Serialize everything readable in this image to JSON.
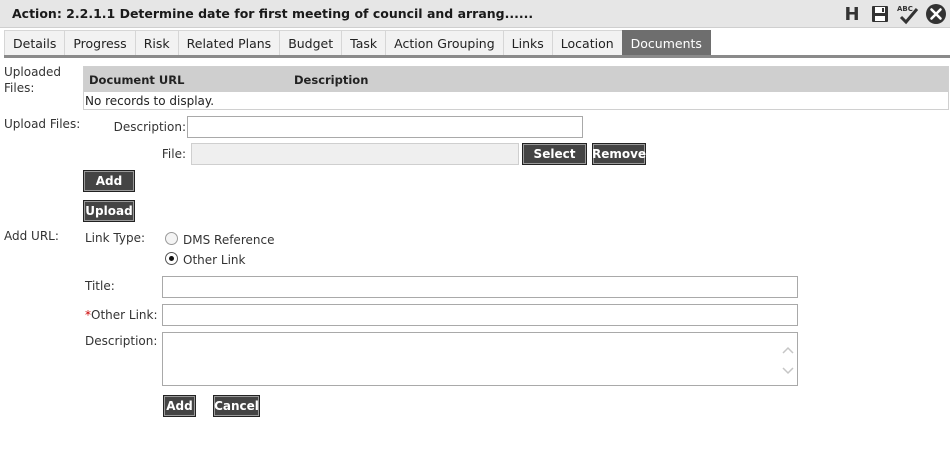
{
  "window": {
    "title": "Action: 2.2.1.1 Determine date for first meeting of council and arrang......",
    "icons": [
      "h-icon",
      "save-icon",
      "spellcheck-icon",
      "close-icon"
    ],
    "h_label": "H",
    "spell_label": "ABC"
  },
  "tabs": [
    {
      "label": "Details"
    },
    {
      "label": "Progress"
    },
    {
      "label": "Risk"
    },
    {
      "label": "Related Plans"
    },
    {
      "label": "Budget"
    },
    {
      "label": "Task"
    },
    {
      "label": "Action Grouping"
    },
    {
      "label": "Links"
    },
    {
      "label": "Location"
    },
    {
      "label": "Documents",
      "active": true
    }
  ],
  "uploaded": {
    "label": "Uploaded Files:",
    "columns": [
      "Document URL",
      "Description"
    ],
    "empty_text": "No records to display."
  },
  "upload": {
    "label": "Upload Files:",
    "description_label": "Description:",
    "description_value": "",
    "file_label": "File:",
    "file_value": "",
    "select_label": "Select",
    "remove_label": "Remove",
    "add_label": "Add",
    "upload_label": "Upload"
  },
  "add_url": {
    "label": "Add URL:",
    "link_type_label": "Link Type:",
    "options": [
      {
        "label": "DMS Reference",
        "checked": false
      },
      {
        "label": "Other Link",
        "checked": true
      }
    ],
    "title_label": "Title:",
    "title_value": "",
    "required_mark": "*",
    "other_link_label": "Other Link:",
    "other_link_value": "",
    "description_label": "Description:",
    "description_value": "",
    "add_label": "Add",
    "cancel_label": "Cancel"
  },
  "colors": {
    "active_tab": "#6e6e6e",
    "button": "#444444",
    "header_bar": "#e6e6e6",
    "table_header": "#cfcfcf",
    "required": "#cc0000"
  }
}
